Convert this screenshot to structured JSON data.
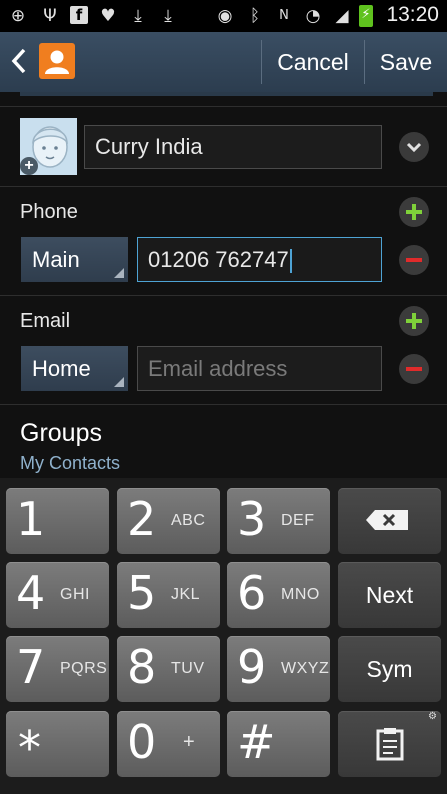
{
  "status_bar": {
    "time": "13:20",
    "icons": [
      "add-icon",
      "usb-icon",
      "facebook-icon",
      "heart-shield-icon",
      "download-icon",
      "download-icon",
      "eye-icon",
      "bluetooth-icon",
      "nfc-icon",
      "wifi-icon",
      "signal-icon",
      "battery-charging-icon"
    ]
  },
  "action_bar": {
    "cancel_label": "Cancel",
    "save_label": "Save",
    "accent_color": "#f07e1f"
  },
  "contact": {
    "name_value": "Curry India"
  },
  "phone": {
    "section_label": "Phone",
    "type_label": "Main",
    "number_value": "01206 762747"
  },
  "email": {
    "section_label": "Email",
    "type_label": "Home",
    "placeholder": "Email address"
  },
  "groups": {
    "title": "Groups",
    "value": "My Contacts"
  },
  "keyboard": {
    "rows": [
      [
        {
          "digit": "1",
          "letters": ""
        },
        {
          "digit": "2",
          "letters": "ABC"
        },
        {
          "digit": "3",
          "letters": "DEF"
        },
        {
          "special": "backspace"
        }
      ],
      [
        {
          "digit": "4",
          "letters": "GHI"
        },
        {
          "digit": "5",
          "letters": "JKL"
        },
        {
          "digit": "6",
          "letters": "MNO"
        },
        {
          "label": "Next"
        }
      ],
      [
        {
          "digit": "7",
          "letters": "PQRS"
        },
        {
          "digit": "8",
          "letters": "TUV"
        },
        {
          "digit": "9",
          "letters": "WXYZ"
        },
        {
          "label": "Sym"
        }
      ],
      [
        {
          "digit": "*",
          "letters": ""
        },
        {
          "digit": "0",
          "letters": "+"
        },
        {
          "digit": "#",
          "letters": ""
        },
        {
          "special": "clipboard"
        }
      ]
    ]
  }
}
